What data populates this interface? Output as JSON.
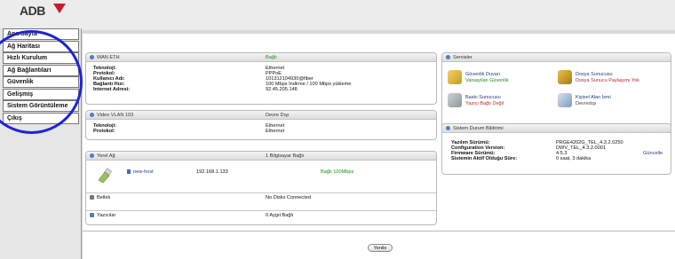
{
  "brand": {
    "logo_text": "ADB"
  },
  "sidebar": {
    "items": [
      {
        "label": "Ana Sayfa"
      },
      {
        "label": "Ağ Haritası"
      },
      {
        "label": "Hızlı Kurulum"
      },
      {
        "label": "Ağ Bağlantıları"
      },
      {
        "label": "Güvenlik"
      },
      {
        "label": "Gelişmiş"
      },
      {
        "label": "Sistem Görüntüleme"
      },
      {
        "label": "Çıkış"
      }
    ]
  },
  "wan": {
    "title": "WAN ETH",
    "status": "Bağlı",
    "rows": [
      {
        "label": "Teknoloji:",
        "value": "Ethernet"
      },
      {
        "label": "Protokol:",
        "value": "PPPoE"
      },
      {
        "label": "Kullanıcı Adı:",
        "value": "101312104930@fiber"
      },
      {
        "label": "Bağlantı Hızı:",
        "value": "100 Mbps İndirme / 100 Mbps yükleme"
      },
      {
        "label": "Internet Adresi:",
        "value": "92.45.205.148"
      }
    ]
  },
  "video": {
    "title": "Video VLAN 103",
    "status": "Devre Dışı",
    "rows": [
      {
        "label": "Teknoloji:",
        "value": "Ethernet"
      },
      {
        "label": "Protokol:",
        "value": "Ethernet"
      }
    ]
  },
  "lan": {
    "title": "Yerel Ağ",
    "status": "1 Bilgisayar Bağlı",
    "device": {
      "name": "new-host",
      "ip": "192.168.1.133",
      "state": "Bağlı 100Mbps"
    }
  },
  "storage": {
    "title": "Bellek",
    "status": "No Disks Connected"
  },
  "printers": {
    "title": "Yazıcılar",
    "status": "0 Aygıt Bağlı"
  },
  "services": {
    "title": "Servisler",
    "items": [
      {
        "name": "Güvenlik Duvarı",
        "detail": "Varsayılan Güvenlik"
      },
      {
        "name": "Dosya Sunucusu",
        "detail": "Dosya Sunucu Paylaşımı Yok"
      },
      {
        "name": "Baskı Sunucusu",
        "detail": "Yazıcı Bağlı Değil"
      },
      {
        "name": "Kişisel Alan İsmi",
        "detail": "Devredışı"
      }
    ]
  },
  "system": {
    "title": "Sistem Durum Bildirimi",
    "rows": [
      {
        "label": "Yazılım Sürümü:",
        "value": "PRGE4202G_TEL_4.3.2.0250"
      },
      {
        "label": "Configuration Version:",
        "value": "DWV_TEL_4.3.2.0001"
      },
      {
        "label": "Firmware Sürümü:",
        "value": "4.5.3"
      },
      {
        "label": "Sistemin Aktif Olduğu Süre:",
        "value": "0 saat, 3 dakika"
      }
    ],
    "update_label": "Güncelle"
  },
  "footer": {
    "refresh_label": "Yenile"
  },
  "colors": {
    "highlight_ring": "#1d25d6",
    "ok_green": "#1a8d1a",
    "warn_red": "#c0282a"
  }
}
